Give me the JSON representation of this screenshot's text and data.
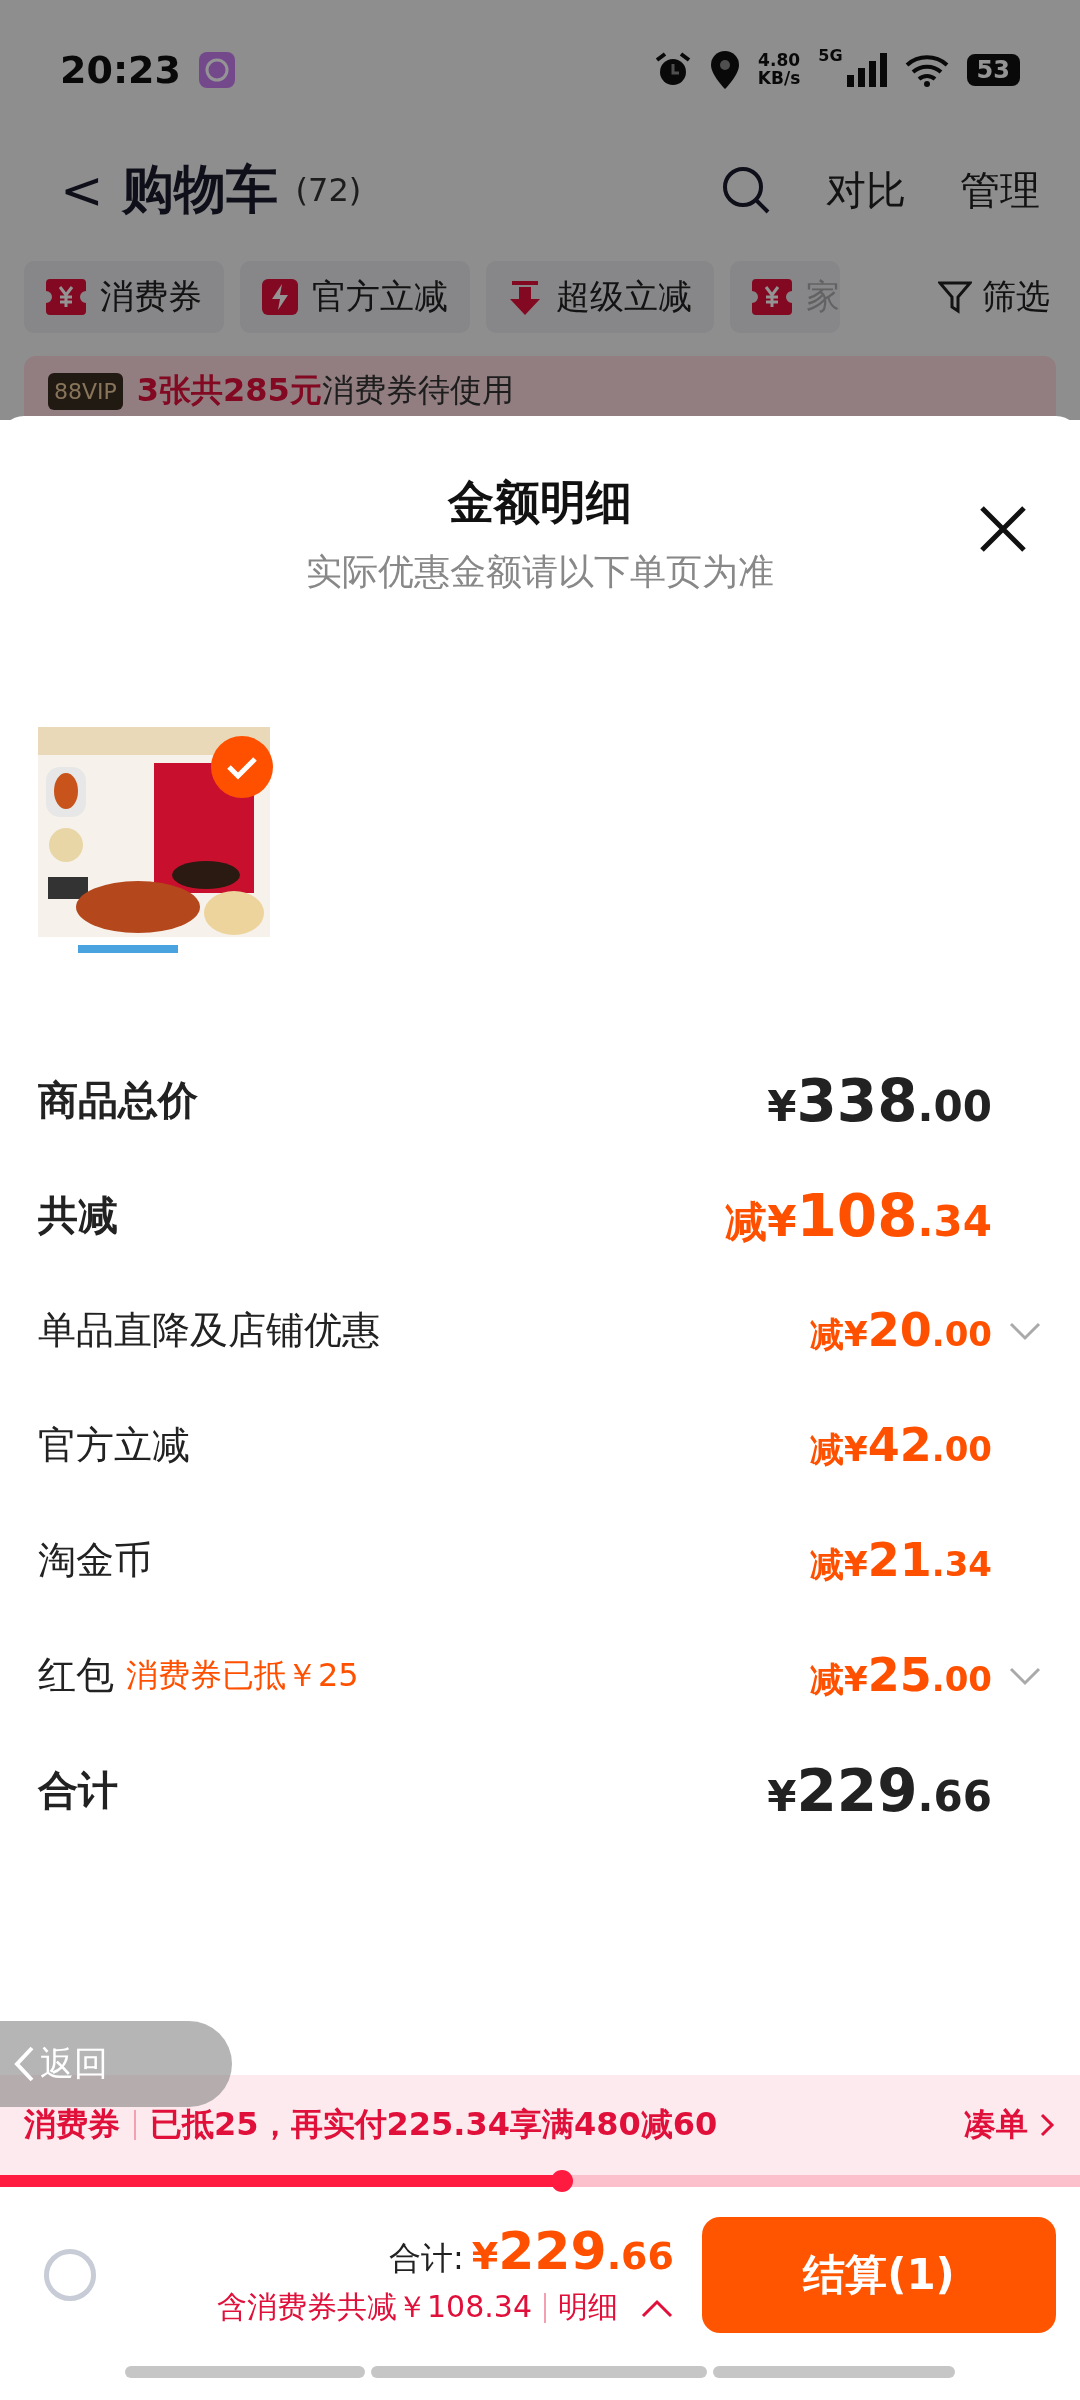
{
  "status_bar": {
    "time": "20:23",
    "speed_value": "4.80",
    "speed_unit": "KB/s",
    "network": "5G",
    "battery": "53"
  },
  "header": {
    "back": "<",
    "title": "购物车",
    "count": "(72)",
    "actions": [
      "对比",
      "管理"
    ]
  },
  "filter_chips": [
    {
      "label": "消费券",
      "kind": "ticket",
      "faded": false
    },
    {
      "label": "官方立减",
      "kind": "bolt",
      "faded": false
    },
    {
      "label": "超级立减",
      "kind": "arrow",
      "faded": false
    },
    {
      "label": "家",
      "kind": "ticket",
      "faded": true
    }
  ],
  "filter_button": "筛选",
  "vip_banner": {
    "badge": "88VIP",
    "text": "**3张共285元**消费券待使用"
  },
  "sheet": {
    "title": "金额明细",
    "subtitle": "实际优惠金额请以下单页为准",
    "product": {
      "kind": "picture",
      "selected": true
    },
    "rows": [
      {
        "kind": "total",
        "label": "商品总价",
        "amount": "¥338.00",
        "expandable": false
      },
      {
        "kind": "discount_total",
        "label": "共减",
        "amount": "减¥108.34",
        "expandable": false
      },
      {
        "kind": "item",
        "label": "单品直降及店铺优惠",
        "amount": "减¥20.00",
        "expandable": true
      },
      {
        "kind": "item",
        "label": "官方立减",
        "amount": "减¥42.00",
        "expandable": false
      },
      {
        "kind": "item",
        "label": "淘金币",
        "amount": "减¥21.34",
        "expandable": false
      },
      {
        "kind": "item",
        "label": "红包",
        "note": "消费券已抵￥25",
        "amount": "减¥25.00",
        "expandable": true
      },
      {
        "kind": "total",
        "label": "合计",
        "amount": "¥229.66",
        "expandable": false
      }
    ]
  },
  "back_overlay": "返回",
  "coupon_bar": {
    "tag": "消费券",
    "text": "已抵25，再实付225.34享满480减60",
    "link": "凑单",
    "level": 0.52
  },
  "checkout_bar": {
    "checked": false,
    "total_label": "合计:",
    "total": "¥229.66",
    "savings": "含消费券共减￥108.34",
    "details": "明细",
    "button": "结算(1)"
  }
}
